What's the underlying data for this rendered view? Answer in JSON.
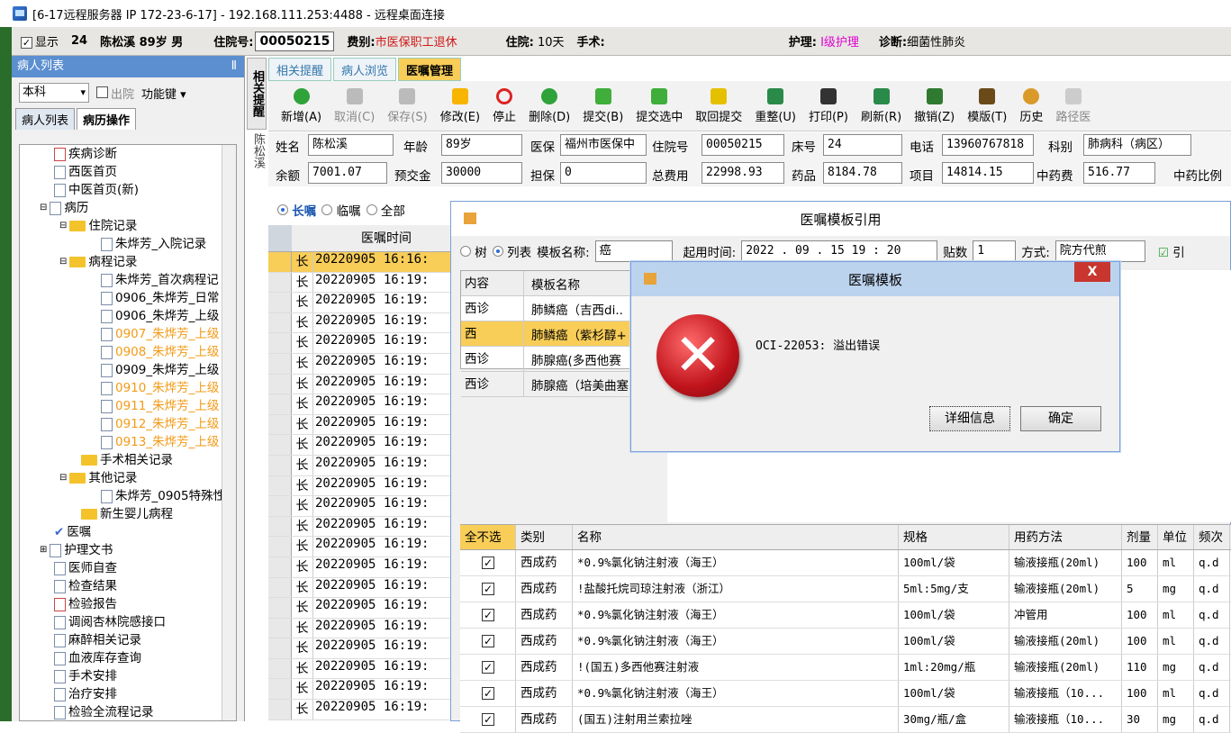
{
  "window": {
    "title": "[6-17远程服务器 IP 172-23-6-17] - 192.168.111.253:4488 - 远程桌面连接"
  },
  "infobar": {
    "show": "显示",
    "bed": "24",
    "patient": "陈松溪 89岁 男",
    "inpatient_label": "住院号:",
    "inpatient_no": "00050215",
    "fee_label": "费别:",
    "fee_value": "市医保职工退休",
    "stay_label": "住院:",
    "stay_value": "10天",
    "surgery_label": "手术:",
    "care_label": "护理:",
    "care_value": "Ⅰ级护理",
    "diag_label": "诊断:",
    "diag_value": "细菌性肺炎"
  },
  "left": {
    "header": "病人列表",
    "pin": "Ⅱ",
    "dept": "本科",
    "discharge": "出院",
    "func": "功能键",
    "tab1": "病人列表",
    "tab2": "病历操作",
    "tree": [
      "疾病诊断",
      "西医首页",
      "中医首页(新)",
      "病历",
      "住院记录",
      "朱烨芳_入院记录",
      "病程记录",
      "朱烨芳_首次病程记",
      "0906_朱烨芳_日常",
      "0906_朱烨芳_上级",
      "0907_朱烨芳_上级",
      "0908_朱烨芳_上级",
      "0909_朱烨芳_上级",
      "0910_朱烨芳_上级",
      "0911_朱烨芳_上级",
      "0912_朱烨芳_上级",
      "0913_朱烨芳_上级",
      "手术相关记录",
      "其他记录",
      "朱烨芳_0905特殊性",
      "新生婴儿病程",
      "医嘱",
      "护理文书",
      "医师自查",
      "检查结果",
      "检验报告",
      "调阅杏林院感接口",
      "麻醉相关记录",
      "血液库存查询",
      "手术安排",
      "治疗安排",
      "检验全流程记录"
    ]
  },
  "sidetab": "相关提醒",
  "sidename": "陈松溪",
  "tabs": [
    "相关提醒",
    "病人浏览",
    "医嘱管理"
  ],
  "toolbar": [
    "新增(A)",
    "取消(C)",
    "保存(S)",
    "修改(E)",
    "停止",
    "删除(D)",
    "提交(B)",
    "提交选中",
    "取回提交",
    "重整(U)",
    "打印(P)",
    "刷新(R)",
    "撤销(Z)",
    "模版(T)",
    "历史",
    "路径医"
  ],
  "form": {
    "name_l": "姓名",
    "name": "陈松溪",
    "age_l": "年龄",
    "age": "89岁",
    "ins_l": "医保",
    "ins": "福州市医保中",
    "no_l": "住院号",
    "no": "00050215",
    "bed_l": "床号",
    "bed": "24",
    "tel_l": "电话",
    "tel": "13960767818",
    "dept_l": "科别",
    "dept": "肺病科（病区）",
    "bal_l": "余额",
    "bal": "7001.07",
    "pre_l": "预交金",
    "pre": "30000",
    "gua_l": "担保",
    "gua": "0",
    "tot_l": "总费用",
    "tot": "22998.93",
    "drug_l": "药品",
    "drug": "8184.78",
    "item_l": "项目",
    "item": "14814.15",
    "tcm_l": "中药费",
    "tcm": "516.77",
    "ratio_l": "中药比例"
  },
  "orders": {
    "long": "长嘱",
    "temp": "临嘱",
    "all": "全部",
    "col": "医嘱时间",
    "rows": [
      "20220905 16:16:",
      "20220905 16:19:",
      "20220905 16:19:",
      "20220905 16:19:",
      "20220905 16:19:",
      "20220905 16:19:",
      "20220905 16:19:",
      "20220905 16:19:",
      "20220905 16:19:",
      "20220905 16:19:",
      "20220905 16:19:",
      "20220905 16:19:",
      "20220905 16:19:",
      "20220905 16:19:",
      "20220905 16:19:",
      "20220905 16:19:",
      "20220905 16:19:",
      "20220905 16:19:",
      "20220905 16:19:",
      "20220905 16:19:",
      "20220905 16:19:",
      "20220905 16:19:",
      "20220905 16:19:"
    ],
    "mark": "长"
  },
  "dlg1": {
    "title": "医嘱模板引用",
    "tree": "树",
    "list": "列表",
    "tpl_name_l": "模板名称:",
    "tpl_name": "癌",
    "start_l": "起用时间:",
    "start": "2022 . 09 . 15   19 : 20",
    "days_l": "贴数",
    "days": "1",
    "way_l": "方式:",
    "way": "院方代煎",
    "ok": "引",
    "tcols": [
      "内容",
      "模板名称"
    ],
    "trows": [
      [
        "西诊",
        "肺鳞癌（吉西di.."
      ],
      [
        "西",
        "肺鳞癌（紫杉醇+"
      ],
      [
        "西诊",
        "肺腺癌(多西他赛"
      ],
      [
        "西诊",
        "肺腺癌（培美曲塞"
      ]
    ],
    "dcols": [
      "全不选",
      "类别",
      "名称",
      "规格",
      "用药方法",
      "剂量",
      "单位",
      "频次"
    ],
    "drows": [
      [
        "西成药",
        "*0.9%氯化钠注射液（海王）",
        "100ml/袋",
        "输液接瓶(20ml)",
        "100",
        "ml",
        "q.d"
      ],
      [
        "西成药",
        "!盐酸托烷司琼注射液（浙江）",
        "5ml:5mg/支",
        "输液接瓶(20ml)",
        "5",
        "mg",
        "q.d"
      ],
      [
        "西成药",
        "*0.9%氯化钠注射液（海王）",
        "100ml/袋",
        "冲管用",
        "100",
        "ml",
        "q.d"
      ],
      [
        "西成药",
        "*0.9%氯化钠注射液（海王）",
        "100ml/袋",
        "输液接瓶(20ml)",
        "100",
        "ml",
        "q.d"
      ],
      [
        "西成药",
        "!(国五)多西他赛注射液",
        "1ml:20mg/瓶",
        "输液接瓶(20ml)",
        "110",
        "mg",
        "q.d"
      ],
      [
        "西成药",
        "*0.9%氯化钠注射液（海王）",
        "100ml/袋",
        "输液接瓶（10...",
        "100",
        "ml",
        "q.d"
      ],
      [
        "西成药",
        "(国五)注射用兰索拉唑",
        "30mg/瓶/盒",
        "输液接瓶（10...",
        "30",
        "mg",
        "q.d"
      ]
    ]
  },
  "dlg2": {
    "title": "医嘱模板",
    "close": "X",
    "msg": "OCI-22053: 溢出错误",
    "detail": "详细信息",
    "ok": "确定"
  }
}
